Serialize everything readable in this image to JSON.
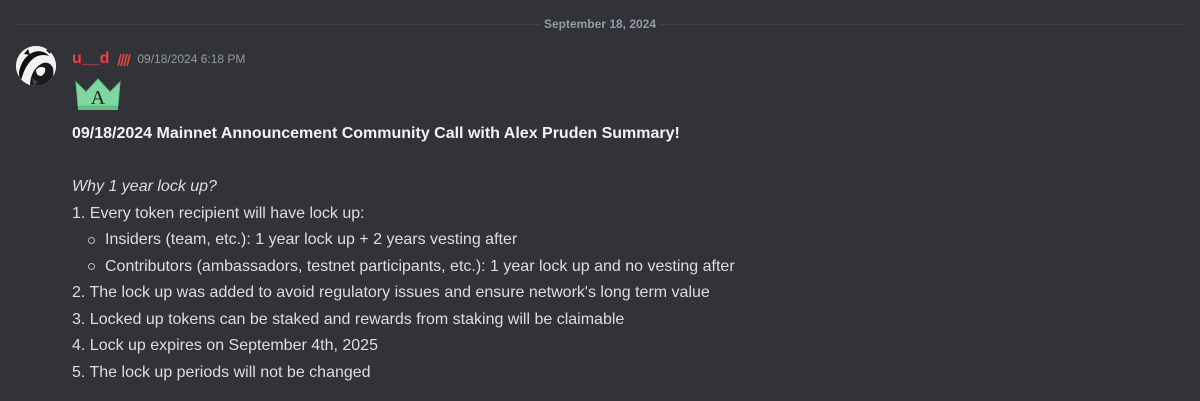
{
  "divider": {
    "date": "September 18, 2024"
  },
  "message": {
    "username": "u__d",
    "timestamp": "09/18/2024 6:18 PM",
    "avatar_icon": "anime-character-avatar",
    "role_icon": "red-slash-marks-icon",
    "emoji_icon": "green-crown-a-emoji",
    "emoji_letter": "A",
    "title": "09/18/2024 Mainnet Announcement Community Call with Alex Pruden Summary!",
    "question": "Why 1 year lock up?",
    "items": [
      "1. Every token recipient will have lock up:",
      "2. The lock up was added to avoid regulatory issues and ensure network's long term value",
      "3. Locked up tokens can be staked and rewards from staking will be claimable",
      "4. Lock up expires on September 4th, 2025",
      "5. The lock up periods will not be changed"
    ],
    "subitems": [
      "Insiders (team, etc.): 1 year lock up + 2 years vesting after",
      "Contributors (ambassadors, testnet participants, etc.): 1 year lock up and no vesting after"
    ]
  },
  "colors": {
    "background": "#313338",
    "username": "#f23f43",
    "text": "#dbdee1",
    "muted": "#949ba4",
    "emoji_green": "#7fd6a0"
  }
}
